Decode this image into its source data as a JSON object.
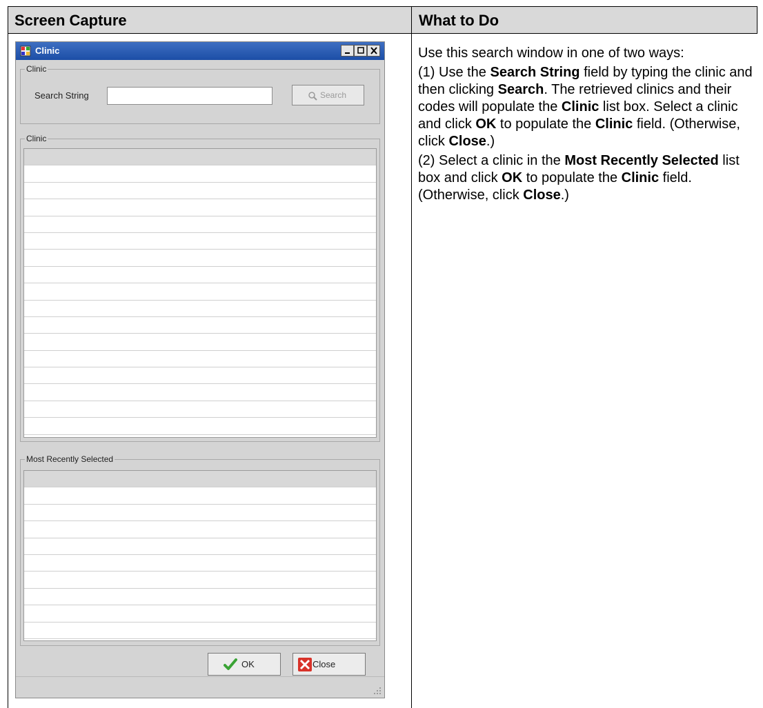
{
  "table": {
    "header_left": "Screen Capture",
    "header_right": "What to Do"
  },
  "dialog": {
    "title": "Clinic",
    "group1_legend": "Clinic",
    "search_label": "Search String",
    "search_value": "",
    "search_button": "Search",
    "group2_legend": "Clinic",
    "group3_legend": "Most Recently Selected",
    "ok_button": "OK",
    "close_button": "Close"
  },
  "instructions": {
    "intro": "Use this search window in one of two ways:",
    "p1_a": "(1) Use the ",
    "p1_b": "Search String",
    "p1_c": " field by typing the clinic and then clicking ",
    "p1_d": "Search",
    "p1_e": ". The retrieved clinics and their codes will populate the ",
    "p1_f": "Clinic",
    "p1_g": " list box. Select a clinic and click ",
    "p1_h": "OK",
    "p1_i": " to populate the ",
    "p1_j": "Clinic",
    "p1_k": " field. (Otherwise, click ",
    "p1_l": "Close",
    "p1_m": ".)",
    "p2_a": "(2) Select a clinic in the ",
    "p2_b": "Most Recently Selected",
    "p2_c": " list box and click ",
    "p2_d": "OK",
    "p2_e": " to populate the ",
    "p2_f": "Clinic",
    "p2_g": " field. (Otherwise, click ",
    "p2_h": "Close",
    "p2_i": ".)"
  },
  "icons": {
    "app": "clinic-app-icon",
    "search": "magnifier-icon",
    "ok": "checkmark-icon",
    "close": "red-x-icon"
  }
}
